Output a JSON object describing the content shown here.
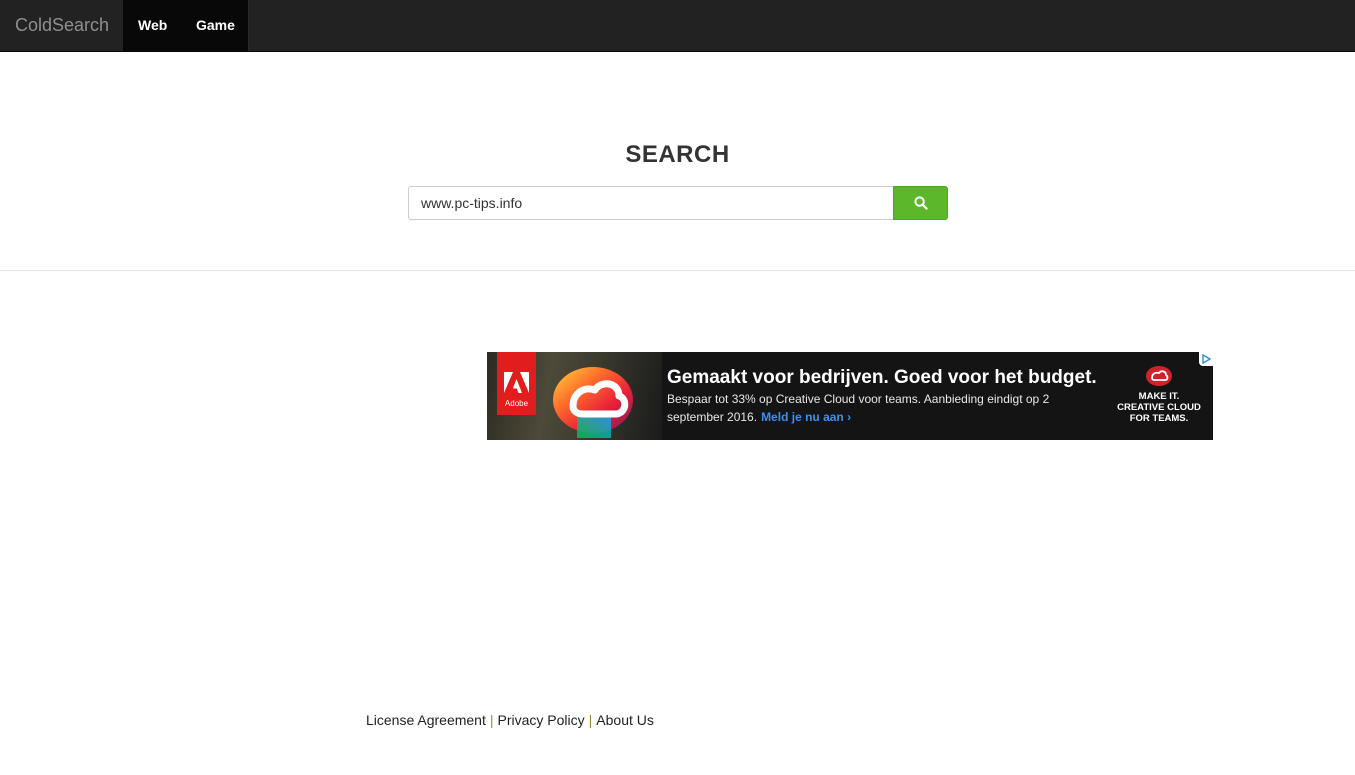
{
  "navbar": {
    "brand": "ColdSearch",
    "links": [
      "Web",
      "Game"
    ]
  },
  "search": {
    "title": "SEARCH",
    "input_value": "www.pc-tips.info",
    "button_icon": "search-icon",
    "button_color": "#5cb82a"
  },
  "ad": {
    "logo_text": "Adobe",
    "headline": "Gemaakt voor bedrijven. Goed voor het budget.",
    "body": "Bespaar tot 33% op Creative Cloud voor teams. Aanbieding eindigt op 2 september 2016.",
    "cta": "Meld je nu aan ›",
    "right_line1": "MAKE IT.",
    "right_line2": "CREATIVE CLOUD",
    "right_line3": "FOR TEAMS.",
    "choices_icon": "adchoices-icon"
  },
  "footer": {
    "links": [
      "License Agreement",
      "Privacy Policy",
      "About Us"
    ],
    "separator": "|"
  }
}
